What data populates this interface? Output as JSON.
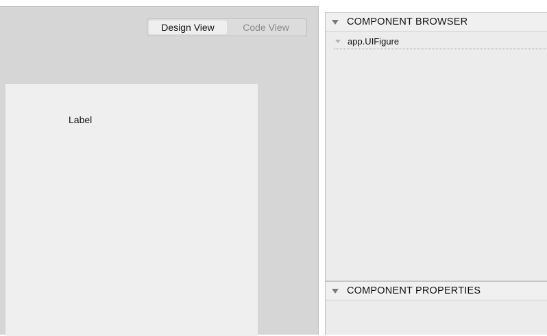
{
  "toolbar": {
    "design_view_label": "Design View",
    "code_view_label": "Code View",
    "active_view": "Design View"
  },
  "canvas": {
    "label_text": "Label"
  },
  "component_browser": {
    "title": "COMPONENT BROWSER",
    "items": [
      {
        "label": "app.UIFigure",
        "icon": "tree-collapse-triangle-icon"
      }
    ]
  },
  "component_properties": {
    "title": "COMPONENT PROPERTIES"
  },
  "colors": {
    "canvas_background": "#d6d6d6",
    "figure_background": "#efefef",
    "panel_background": "#ececec",
    "inactive_text": "#8a8a8a"
  }
}
